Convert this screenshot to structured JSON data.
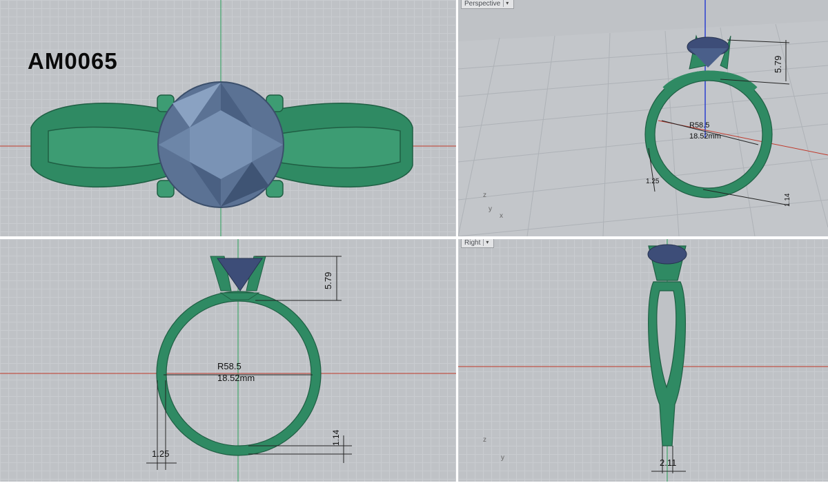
{
  "model_code": "AM0065",
  "viewports": {
    "top": {
      "label": ""
    },
    "perspective": {
      "label": "Perspective"
    },
    "front": {
      "label": ""
    },
    "right": {
      "label": "Right"
    }
  },
  "dimensions": {
    "prong_height": "5.79",
    "ring_size": "R58.5",
    "inner_diameter": "18.52mm",
    "band_width_front": "1.25",
    "band_thickness": "1.14",
    "band_width_side": "2.11"
  },
  "axes": {
    "x": "x",
    "y": "y",
    "z": "z"
  },
  "colors": {
    "viewport_bg": "#bfc2c6",
    "metal": "#2f8a63",
    "gem": "#5b7294",
    "x_axis": "#c0392b",
    "y_axis": "#2aa15a",
    "z_axis": "#2a3fd0"
  }
}
